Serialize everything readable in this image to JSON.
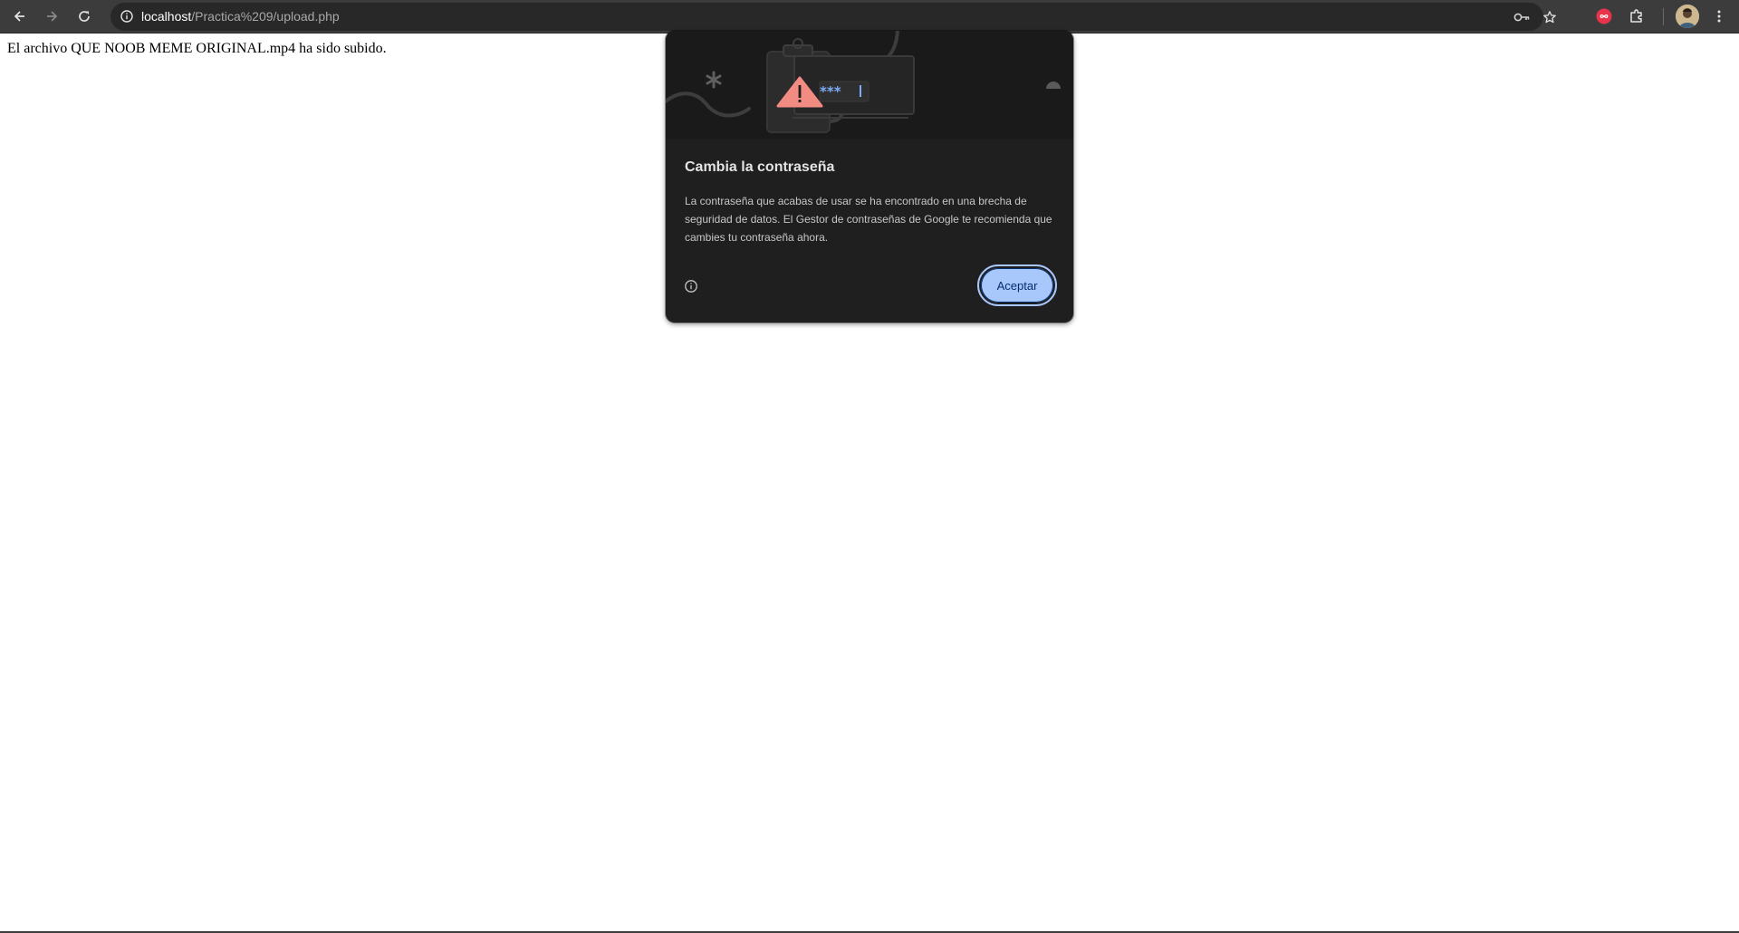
{
  "browser": {
    "url_host": "localhost",
    "url_path": "/Practica%209/upload.php",
    "icons": {
      "back": "arrow-back-icon",
      "forward": "arrow-forward-icon",
      "reload": "reload-icon",
      "site_info": "info-icon",
      "password_key": "key-icon",
      "bookmark": "star-icon",
      "extension_red": "infinity-badge-icon",
      "extensions": "puzzle-icon",
      "menu": "kebab-menu-icon"
    }
  },
  "page": {
    "message": "El archivo QUE NOOB MEME ORIGINAL.mp4 ha sido subido."
  },
  "password_bubble": {
    "title": "Cambia la contraseña",
    "body": "La contraseña que acabas de usar se ha encontrado en una brecha de seguridad de datos. El Gestor de contraseñas de Google te recomienda que cambies tu contraseña ahora.",
    "masked_text": "***",
    "accept_label": "Aceptar",
    "colors": {
      "background": "#1f1f1f",
      "button": "#a8c7fa",
      "button_text": "#062e6f",
      "warning": "#f28b82"
    }
  }
}
